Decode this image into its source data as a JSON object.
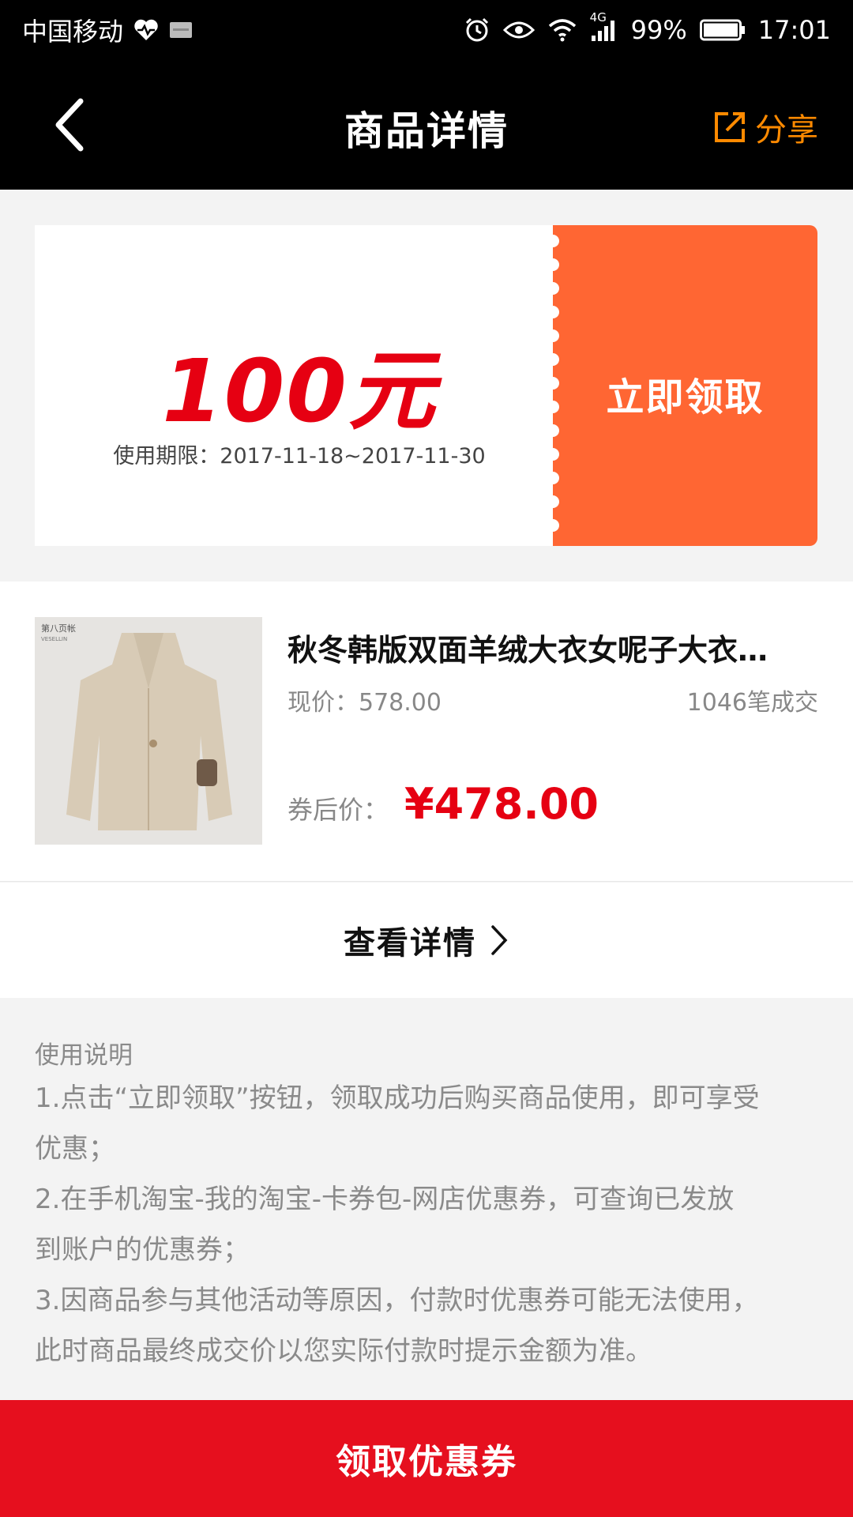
{
  "status_bar": {
    "carrier": "中国移动",
    "network": "4G",
    "battery": "99%",
    "time": "17:01",
    "icons": [
      "heart-pulse-icon",
      "message-icon",
      "alarm-icon",
      "eye-icon",
      "wifi-icon",
      "signal-icon",
      "battery-icon"
    ]
  },
  "nav": {
    "title": "商品详情",
    "share_label": "分享",
    "accent": "#ff8a00"
  },
  "coupon": {
    "amount": "100元",
    "validity": "使用期限：2017-11-18~2017-11-30",
    "claim_label": "立即领取",
    "amount_color": "#e60012",
    "panel_color": "#ff6633"
  },
  "product": {
    "title": "秋冬韩版双面羊绒大衣女呢子大衣…",
    "price": "现价：578.00",
    "sales": "1046笔成交",
    "coupon_price_label": "券后价：",
    "coupon_price": "¥478.00",
    "image_brand": "第八页帐",
    "image_brand_sub": "VESELLIN"
  },
  "details": {
    "label": "查看详情"
  },
  "instructions": {
    "title": "使用说明",
    "lines": [
      "1.点击“立即领取”按钮，领取成功后购买商品使用，即可享受",
      "优惠；",
      "2.在手机淘宝-我的淘宝-卡券包-网店优惠券，可查询已发放",
      "到账户的优惠券；",
      "3.因商品参与其他活动等原因，付款时优惠券可能无法使用，",
      "此时商品最终成交价以您实际付款时提示金额为准。"
    ]
  },
  "bottom": {
    "label": "领取优惠券",
    "color": "#e60f1e"
  }
}
